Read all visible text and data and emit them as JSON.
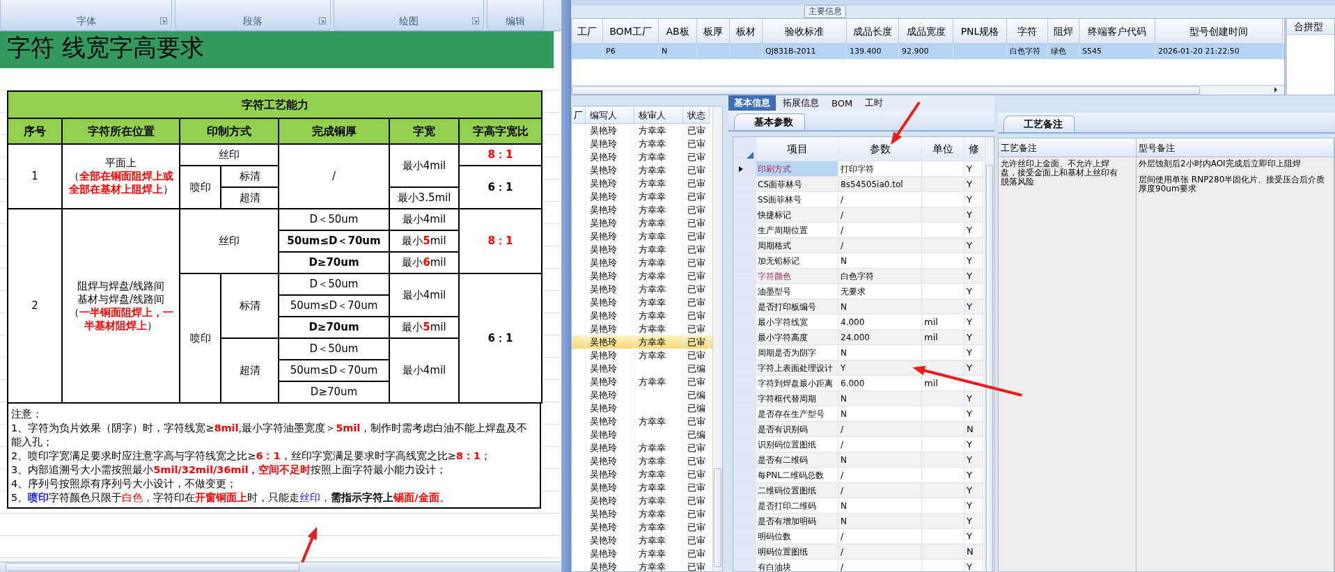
{
  "ribbon": {
    "groups": [
      "字体",
      "段落",
      "绘图",
      "编辑"
    ]
  },
  "sheet": {
    "title": "字符 线宽字高要求",
    "table": {
      "title": "字符工艺能力",
      "columns": [
        {
          "label": "序号"
        },
        {
          "label": "字符所在位置"
        },
        {
          "label": "印制方式",
          "colspan": 2
        },
        {
          "label": "完成铜厚"
        },
        {
          "label": "字宽"
        },
        {
          "label": "字高字宽比"
        }
      ],
      "rows": [
        {
          "cells": [
            {
              "text": "1",
              "rowspan": 3
            },
            {
              "rowspan": 3,
              "parts": [
                {
                  "text": "平面上",
                  "kind": "caption"
                },
                {
                  "text": "（",
                  "kind": "text"
                },
                {
                  "text": "全部在铜面阻焊上或全部在基材上阻焊上",
                  "kind": "warning"
                },
                {
                  "text": "）",
                  "kind": "text"
                }
              ]
            },
            {
              "text": "丝印",
              "colspan": 2
            },
            {
              "text": "/",
              "rowspan": 3
            },
            {
              "text": "最小4mil",
              "rowspan": 2
            },
            {
              "text": "8：1",
              "kind": "warning"
            }
          ]
        },
        {
          "cells": [
            {
              "text": "喷印",
              "rowspan": 2
            },
            {
              "text": "标清"
            },
            {
              "text": "6：1",
              "rowspan": 2,
              "kind": "strong"
            }
          ]
        },
        {
          "cells": [
            {
              "text": "超清"
            },
            {
              "text": "最小3.5mil"
            }
          ]
        },
        {
          "cells": [
            {
              "text": "2",
              "rowspan": 9
            },
            {
              "rowspan": 9,
              "parts": [
                {
                  "text": "阻焊与焊盘/线路间",
                  "kind": "caption"
                },
                {
                  "text": "基材与焊盘/线路间",
                  "kind": "caption"
                },
                {
                  "text": "（",
                  "kind": "text"
                },
                {
                  "text": "一半铜面阻焊上，一半基材阻焊上",
                  "kind": "warning"
                },
                {
                  "text": "）",
                  "kind": "text"
                }
              ]
            },
            {
              "text": "丝印",
              "colspan": 2,
              "rowspan": 3
            },
            {
              "text": "D＜50um"
            },
            {
              "text": "最小4mil"
            },
            {
              "text": "8：1",
              "rowspan": 3,
              "kind": "warning"
            }
          ]
        },
        {
          "cells": [
            {
              "text": "50um≤D＜70um",
              "kind": "strong"
            },
            {
              "parts": [
                {
                  "text": "最小",
                  "kind": "text"
                },
                {
                  "text": "5",
                  "kind": "warning"
                },
                {
                  "text": "mil",
                  "kind": "text"
                }
              ]
            }
          ]
        },
        {
          "cells": [
            {
              "text": "D≥70um",
              "kind": "strong"
            },
            {
              "parts": [
                {
                  "text": "最小",
                  "kind": "text"
                },
                {
                  "text": "6",
                  "kind": "warning"
                },
                {
                  "text": "mil",
                  "kind": "text"
                }
              ]
            }
          ]
        },
        {
          "cells": [
            {
              "text": "喷印",
              "rowspan": 6
            },
            {
              "text": "标清",
              "rowspan": 3
            },
            {
              "text": "D＜50um"
            },
            {
              "text": "最小4mil",
              "rowspan": 2
            },
            {
              "text": "6：1",
              "rowspan": 6,
              "kind": "strong"
            }
          ]
        },
        {
          "cells": [
            {
              "text": "50um≤D＜70um"
            }
          ]
        },
        {
          "cells": [
            {
              "text": "D≥70um",
              "kind": "strong"
            },
            {
              "parts": [
                {
                  "text": "最小",
                  "kind": "text"
                },
                {
                  "text": "5",
                  "kind": "warning"
                },
                {
                  "text": "mil",
                  "kind": "text"
                }
              ]
            }
          ]
        },
        {
          "cells": [
            {
              "text": "超清",
              "rowspan": 3
            },
            {
              "text": "D＜50um"
            },
            {
              "text": "最小4mil",
              "rowspan": 3
            }
          ]
        },
        {
          "cells": [
            {
              "text": "50um≤D＜70um"
            }
          ]
        },
        {
          "cells": [
            {
              "text": "D≥70um"
            }
          ]
        }
      ]
    },
    "notes": {
      "heading": "注意：",
      "lines": [
        [
          {
            "text": "1、字符为负片效果（阴字）时，字符线宽≥",
            "kind": "text"
          },
          {
            "text": "8mil",
            "kind": "warning"
          },
          {
            "text": ",最小字符油墨宽度＞",
            "kind": "text"
          },
          {
            "text": "5mil",
            "kind": "warning"
          },
          {
            "text": "，制作时需考虑白油不能上焊盘及不能入孔；",
            "kind": "text"
          }
        ],
        [
          {
            "text": "2、喷印字宽满足要求时应注意字高与字符线宽之比≥",
            "kind": "text"
          },
          {
            "text": "6：1",
            "kind": "warning"
          },
          {
            "text": "，丝印字宽满足要求时字高线宽之比≥",
            "kind": "text"
          },
          {
            "text": "8：1",
            "kind": "warning"
          },
          {
            "text": "；",
            "kind": "text"
          }
        ],
        [
          {
            "text": "3、内部追溯号大小需按照最小",
            "kind": "text"
          },
          {
            "text": "5mil/32mil/36mil，空间不足时",
            "kind": "warning"
          },
          {
            "text": "按照上面字符最小能力设计；",
            "kind": "text"
          }
        ],
        [
          {
            "text": "4、序列号按照原有序列号大小设计，不做变更；",
            "kind": "text"
          }
        ],
        [
          {
            "text": "5、",
            "kind": "text"
          },
          {
            "text": "喷印",
            "kind": "highlight"
          },
          {
            "text": "字符颜色只限于",
            "kind": "text"
          },
          {
            "text": "白色，",
            "kind": "alert"
          },
          {
            "text": "字符印在",
            "kind": "text"
          },
          {
            "text": "开窗铜面上",
            "kind": "warning"
          },
          {
            "text": "时，只能走",
            "kind": "text"
          },
          {
            "text": "丝印，",
            "kind": "accent"
          },
          {
            "text": "需指示字符上",
            "kind": "strong"
          },
          {
            "text": "锡面/金面",
            "kind": "warning"
          },
          {
            "text": "。",
            "kind": "text"
          }
        ]
      ]
    }
  },
  "main_info": {
    "title": "主要信息",
    "columns": [
      "工厂",
      "BOM工厂",
      "AB板",
      "板厚",
      "板材",
      "验收标准",
      "成品长度",
      "成品宽度",
      "PNL规格",
      "字符",
      "阻焊",
      "终端客户代码",
      "型号创建时间"
    ],
    "rows": [
      {
        "selected": true,
        "cells": [
          null,
          "P6",
          "N",
          null,
          null,
          "QJ831B-2011",
          "139.400",
          "92.900",
          null,
          "白色字符",
          "绿色",
          "S545",
          "2026-01-20 21:22:50"
        ]
      }
    ],
    "side_panel": {
      "title": "合拼型"
    }
  },
  "record_list": {
    "columns": [
      "厂",
      "编写人",
      "核审人",
      "状态"
    ],
    "rows": [
      {
        "selected": false,
        "writer": "吴艳玲",
        "reviewer": "方幸幸",
        "status": "已审"
      },
      {
        "selected": false,
        "writer": "吴艳玲",
        "reviewer": "方幸幸",
        "status": "已审"
      },
      {
        "selected": false,
        "writer": "吴艳玲",
        "reviewer": "方幸幸",
        "status": "已审"
      },
      {
        "selected": false,
        "writer": "吴艳玲",
        "reviewer": "方幸幸",
        "status": "已审"
      },
      {
        "selected": false,
        "writer": "吴艳玲",
        "reviewer": "方幸幸",
        "status": "已审"
      },
      {
        "selected": false,
        "writer": "吴艳玲",
        "reviewer": "方幸幸",
        "status": "已审"
      },
      {
        "selected": false,
        "writer": "吴艳玲",
        "reviewer": "方幸幸",
        "status": "已审"
      },
      {
        "selected": false,
        "writer": "吴艳玲",
        "reviewer": "方幸幸",
        "status": "已审"
      },
      {
        "selected": false,
        "writer": "吴艳玲",
        "reviewer": "方幸幸",
        "status": "已审"
      },
      {
        "selected": false,
        "writer": "吴艳玲",
        "reviewer": "方幸幸",
        "status": "已审"
      },
      {
        "selected": false,
        "writer": "吴艳玲",
        "reviewer": "方幸幸",
        "status": "已审"
      },
      {
        "selected": false,
        "writer": "吴艳玲",
        "reviewer": "方幸幸",
        "status": "已审"
      },
      {
        "selected": false,
        "writer": "吴艳玲",
        "reviewer": "方幸幸",
        "status": "已审"
      },
      {
        "selected": false,
        "writer": "吴艳玲",
        "reviewer": "方幸幸",
        "status": "已审"
      },
      {
        "selected": false,
        "writer": "吴艳玲",
        "reviewer": "方幸幸",
        "status": "已审"
      },
      {
        "selected": false,
        "writer": "吴艳玲",
        "reviewer": "方幸幸",
        "status": "已审"
      },
      {
        "selected": true,
        "writer": "吴艳玲",
        "reviewer": "方幸幸",
        "status": "已审"
      },
      {
        "selected": false,
        "writer": "吴艳玲",
        "reviewer": "方幸幸",
        "status": "已审"
      },
      {
        "selected": false,
        "writer": "吴艳玲",
        "status": "已编"
      },
      {
        "selected": false,
        "writer": "吴艳玲",
        "reviewer": "方幸幸",
        "status": "已审"
      },
      {
        "selected": false,
        "writer": "吴艳玲",
        "status": "已编"
      },
      {
        "selected": false,
        "writer": "吴艳玲",
        "status": "已编"
      },
      {
        "selected": false,
        "writer": "吴艳玲",
        "reviewer": "方幸幸",
        "status": "已审"
      },
      {
        "selected": false,
        "writer": "吴艳玲",
        "status": "已编"
      },
      {
        "selected": false,
        "writer": "吴艳玲",
        "reviewer": "方幸幸",
        "status": "已审"
      },
      {
        "selected": false,
        "writer": "吴艳玲",
        "reviewer": "方幸幸",
        "status": "已审"
      },
      {
        "selected": false,
        "writer": "吴艳玲",
        "reviewer": "方幸幸",
        "status": "已审"
      },
      {
        "selected": false,
        "writer": "吴艳玲",
        "reviewer": "方幸幸",
        "status": "已审"
      },
      {
        "selected": false,
        "writer": "吴艳玲",
        "reviewer": "方幸幸",
        "status": "已审"
      },
      {
        "selected": false,
        "writer": "吴艳玲",
        "reviewer": "方幸幸",
        "status": "已审"
      },
      {
        "selected": false,
        "writer": "吴艳玲",
        "reviewer": "方幸幸",
        "status": "已审"
      },
      {
        "selected": false,
        "writer": "吴艳玲",
        "reviewer": "方幸幸",
        "status": "已审"
      },
      {
        "selected": false,
        "writer": "吴艳玲",
        "reviewer": "方幸幸",
        "status": "已审"
      },
      {
        "selected": false,
        "writer": "吴艳玲",
        "reviewer": "方幸幸",
        "status": "已审"
      }
    ]
  },
  "params": {
    "tabs": [
      {
        "label": "基本信息",
        "selected": true
      },
      {
        "label": "拓展信息",
        "selected": false
      },
      {
        "label": "BOM",
        "selected": false
      },
      {
        "label": "工时",
        "selected": false
      }
    ],
    "subtab": "基本参数",
    "columns": [
      "项目",
      "参数",
      "单位",
      "修"
    ],
    "rows": [
      {
        "item": "印刷方式",
        "value": "打印字符",
        "flag": "Y",
        "selected": true,
        "emphasized": true
      },
      {
        "item": "CS面菲林号",
        "value": "8s54505ia0.tol",
        "flag": "Y",
        "selected": false,
        "emphasized": false
      },
      {
        "item": "SS面菲林号",
        "value": "/",
        "flag": "Y",
        "selected": false,
        "emphasized": false
      },
      {
        "item": "快捷标记",
        "value": "/",
        "flag": "Y",
        "selected": false,
        "emphasized": false
      },
      {
        "item": "生产周期位置",
        "value": "/",
        "flag": "Y",
        "selected": false,
        "emphasized": false
      },
      {
        "item": "周期格式",
        "value": "/",
        "flag": "Y",
        "selected": false,
        "emphasized": false
      },
      {
        "item": "加无铅标记",
        "value": "N",
        "flag": "Y",
        "selected": false,
        "emphasized": false
      },
      {
        "item": "字符颜色",
        "value": "白色字符",
        "flag": "Y",
        "selected": false,
        "emphasized": true
      },
      {
        "item": "油墨型号",
        "value": "无要求",
        "flag": "Y",
        "selected": false,
        "emphasized": false
      },
      {
        "item": "是否打印板编号",
        "value": "N",
        "flag": "Y",
        "selected": false,
        "emphasized": false
      },
      {
        "item": "最小字符线宽",
        "value": "4.000",
        "unit": "mil",
        "flag": "Y",
        "selected": false,
        "emphasized": false
      },
      {
        "item": "最小字符高度",
        "value": "24.000",
        "unit": "mil",
        "flag": "Y",
        "selected": false,
        "emphasized": false
      },
      {
        "item": "周期是否为阴字",
        "value": "N",
        "flag": "Y",
        "selected": false,
        "emphasized": false
      },
      {
        "item": "字符上表面处理设计",
        "value": "Y",
        "flag": "Y",
        "selected": false,
        "emphasized": false
      },
      {
        "item": "字符到焊盘最小距离",
        "value": "6.000",
        "unit": "mil",
        "selected": false,
        "emphasized": false
      },
      {
        "item": "字符框代替周期",
        "value": "N",
        "flag": "Y",
        "selected": false,
        "emphasized": false
      },
      {
        "item": "是否存在生产型号",
        "value": "N",
        "flag": "Y",
        "selected": false,
        "emphasized": false
      },
      {
        "item": "是否有识别码",
        "value": "/",
        "flag": "N",
        "selected": false,
        "emphasized": false
      },
      {
        "item": "识别码位置图纸",
        "value": "/",
        "flag": "Y",
        "selected": false,
        "emphasized": false
      },
      {
        "item": "是否有二维码",
        "value": "N",
        "flag": "Y",
        "selected": false,
        "emphasized": false
      },
      {
        "item": "每PNL二维码总数",
        "value": "/",
        "flag": "Y",
        "selected": false,
        "emphasized": false
      },
      {
        "item": "二维码位置图纸",
        "value": "/",
        "flag": "Y",
        "selected": false,
        "emphasized": false
      },
      {
        "item": "是否打印二维码",
        "value": "N",
        "flag": "Y",
        "selected": false,
        "emphasized": false
      },
      {
        "item": "是否有增加明码",
        "value": "N",
        "flag": "Y",
        "selected": false,
        "emphasized": false
      },
      {
        "item": "明码位数",
        "value": "/",
        "flag": "Y",
        "selected": false,
        "emphasized": false
      },
      {
        "item": "明码位置图纸",
        "value": "/",
        "flag": "N",
        "selected": false,
        "emphasized": false
      },
      {
        "item": "有白油块",
        "value": "/",
        "flag": "Y",
        "selected": false,
        "emphasized": false
      }
    ]
  },
  "notes_panel": {
    "tab": "工艺备注",
    "columns": [
      "工艺备注",
      "型号备注"
    ],
    "process_note": "允许丝印上金面、不允许上焊盘，接受金面上和基材上丝印有脱落风险",
    "model_notes": [
      "外层蚀刻后2小时内AOI完成后立即印上阻焊",
      "层间使用单张 RNP280半固化片、接受压合后介质厚度90um要求"
    ]
  }
}
